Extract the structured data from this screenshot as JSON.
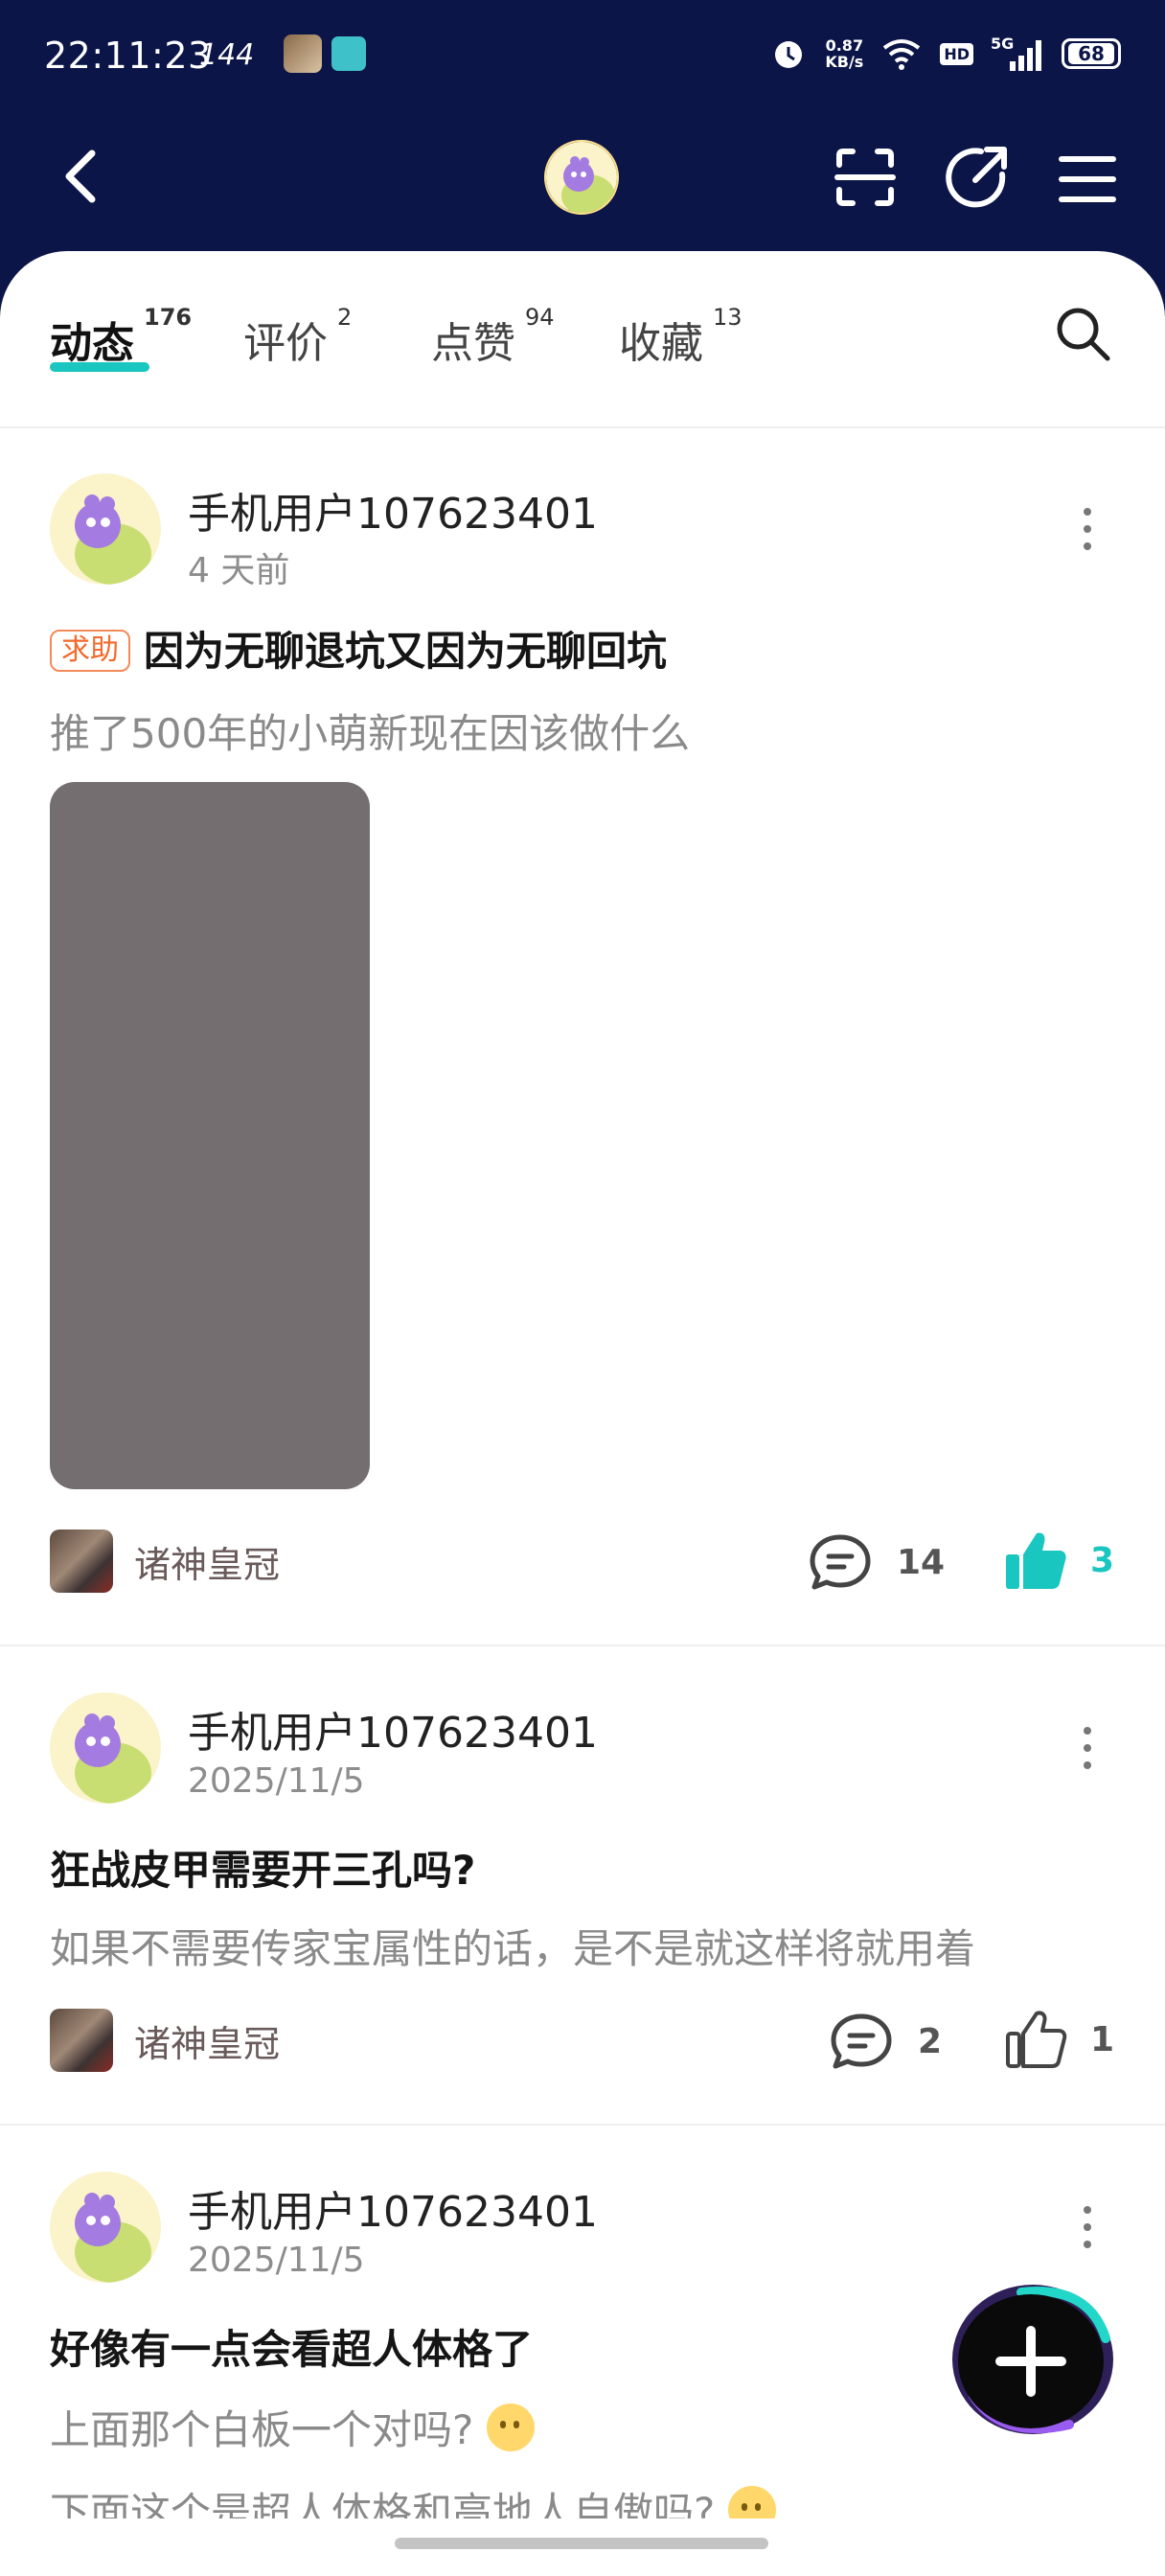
{
  "status_bar": {
    "time": "22:11:23",
    "refresh": "144",
    "net_speed_value": "0.87",
    "net_speed_unit": "KB/s",
    "hd": "HD",
    "network": "5G",
    "battery": "68"
  },
  "tabs": [
    {
      "label": "动态",
      "count": "176"
    },
    {
      "label": "评价",
      "count": "2"
    },
    {
      "label": "点赞",
      "count": "94"
    },
    {
      "label": "收藏",
      "count": "13"
    }
  ],
  "posts": [
    {
      "username": "手机用户107623401",
      "time": "4 天前",
      "tag": "求助",
      "title": "因为无聊退坑又因为无聊回坑",
      "body": "推了500年的小萌新现在因该做什么",
      "game": "诸神皇冠",
      "comments": "14",
      "likes": "3"
    },
    {
      "username": "手机用户107623401",
      "time": "2025/11/5",
      "title": "狂战皮甲需要开三孔吗?",
      "body": "如果不需要传家宝属性的话，是不是就这样将就用着",
      "game": "诸神皇冠",
      "comments": "2",
      "likes": "1"
    },
    {
      "username": "手机用户107623401",
      "time": "2025/11/5",
      "title": "好像有一点会看超人体格了",
      "body1": "上面那个白板一个对吗?",
      "body2": "下面这个是超人体格和高地人自傲吗?"
    }
  ],
  "colors": {
    "header_bg": "#0c1548",
    "accent": "#19c6c0",
    "tag": "#f26a2c"
  }
}
